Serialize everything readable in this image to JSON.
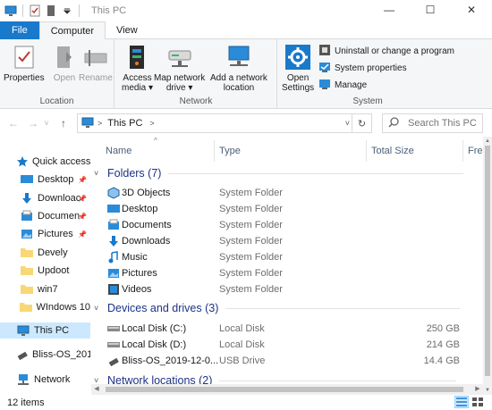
{
  "window": {
    "title": "This PC",
    "minimize": "—",
    "maximize": "☐",
    "close": "✕"
  },
  "ribbon_tabs": [
    "File",
    "Computer",
    "View"
  ],
  "ribbon": {
    "location": {
      "label": "Location",
      "properties": "Properties",
      "open": "Open",
      "rename": "Rename"
    },
    "network": {
      "label": "Network",
      "access_media": [
        "Access",
        "media ▾"
      ],
      "map_network_drive": [
        "Map network",
        "drive ▾"
      ],
      "add_network_location": [
        "Add a network",
        "location"
      ]
    },
    "system": {
      "label": "System",
      "open_settings": [
        "Open",
        "Settings"
      ],
      "uninstall": "Uninstall or change a program",
      "system_properties": "System properties",
      "manage": "Manage"
    }
  },
  "address": {
    "back": "←",
    "forward": "→",
    "recent": "˅",
    "up": "↑",
    "crumb": "This PC",
    "chevron": ">",
    "dropdown": "˅",
    "refresh": "↻",
    "search_placeholder": "Search This PC"
  },
  "nav_pane": {
    "quick_access": "Quick access",
    "pinned": [
      {
        "label": "Desktop",
        "icon": "desktop-icon"
      },
      {
        "label": "Downloac",
        "icon": "downloads-icon"
      },
      {
        "label": "Documen",
        "icon": "documents-icon"
      },
      {
        "label": "Pictures",
        "icon": "pictures-icon"
      }
    ],
    "folders": [
      "Devely",
      "Updoot",
      "win7",
      "WIndows 10"
    ],
    "this_pc": "This PC",
    "bliss": "Bliss-OS_2019-",
    "network": "Network"
  },
  "columns": {
    "name": "Name",
    "type": "Type",
    "total_size": "Total Size",
    "free": "Fre"
  },
  "groups": {
    "folders": "Folders (7)",
    "devices": "Devices and drives (3)",
    "network": "Network locations (2)"
  },
  "folders": [
    {
      "name": "3D Objects",
      "type": "System Folder",
      "icon": "3d-objects-icon"
    },
    {
      "name": "Desktop",
      "type": "System Folder",
      "icon": "desktop-icon"
    },
    {
      "name": "Documents",
      "type": "System Folder",
      "icon": "documents-icon"
    },
    {
      "name": "Downloads",
      "type": "System Folder",
      "icon": "downloads-icon"
    },
    {
      "name": "Music",
      "type": "System Folder",
      "icon": "music-icon"
    },
    {
      "name": "Pictures",
      "type": "System Folder",
      "icon": "pictures-icon"
    },
    {
      "name": "Videos",
      "type": "System Folder",
      "icon": "videos-icon"
    }
  ],
  "drives": [
    {
      "name": "Local Disk (C:)",
      "type": "Local Disk",
      "size": "250 GB",
      "icon": "hard-drive-icon"
    },
    {
      "name": "Local Disk (D:)",
      "type": "Local Disk",
      "size": "214 GB",
      "icon": "hard-drive-icon"
    },
    {
      "name": "Bliss-OS_2019-12-0...",
      "type": "USB Drive",
      "size": "14.4 GB",
      "icon": "usb-drive-icon"
    }
  ],
  "status": {
    "items": "12 items"
  },
  "colors": {
    "accent": "#1979ca",
    "group_header": "#1e3287",
    "selection": "#cce8ff",
    "folder": "#f8d775"
  }
}
